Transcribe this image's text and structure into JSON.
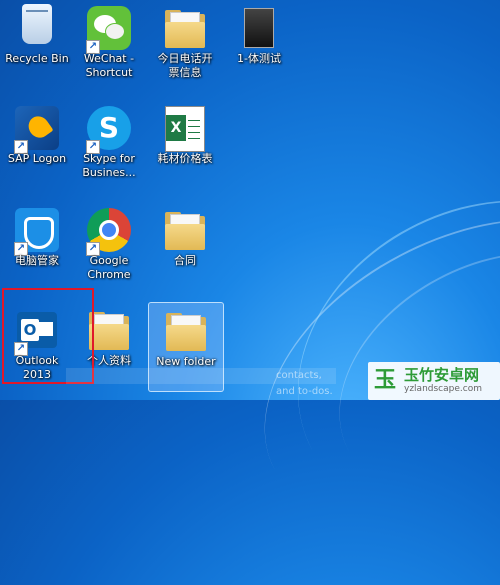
{
  "desktop": {
    "icons": [
      {
        "label": "Recycle Bin",
        "icon": "recycle-bin-icon"
      },
      {
        "label": "WeChat -\nShortcut",
        "icon": "wechat-icon"
      },
      {
        "label": "今日电话开\n票信息",
        "icon": "folder-icon"
      },
      {
        "label": "1-体测试",
        "icon": "file-icon"
      },
      {
        "label": "SAP Logon",
        "icon": "sap-logon-icon"
      },
      {
        "label": "Skype for\nBusines...",
        "icon": "skype-icon"
      },
      {
        "label": "耗材价格表",
        "icon": "excel-icon"
      },
      {
        "label": "电脑管家",
        "icon": "tencent-pc-manager-icon"
      },
      {
        "label": "Google\nChrome",
        "icon": "chrome-icon"
      },
      {
        "label": "合同",
        "icon": "folder-icon"
      },
      {
        "label": "Outlook 2013",
        "icon": "outlook-icon"
      },
      {
        "label": "个人资料",
        "icon": "folder-icon"
      },
      {
        "label": "New folder",
        "icon": "folder-icon"
      }
    ]
  },
  "tooltip": {
    "text": "contacts, and to-dos."
  },
  "watermark": {
    "title": "玉竹安卓网",
    "subtitle": "yzlandscape.com",
    "logo": "玉"
  }
}
